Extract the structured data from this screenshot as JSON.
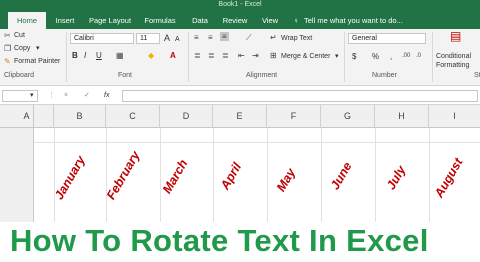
{
  "window": {
    "title": "Book1 - Excel"
  },
  "tabs": [
    "Home",
    "Insert",
    "Page Layout",
    "Formulas",
    "Data",
    "Review",
    "View"
  ],
  "tell_me": "Tell me what you want to do...",
  "clipboard": {
    "cut": "Cut",
    "copy": "Copy",
    "format_painter": "Format Painter",
    "label": "Clipboard"
  },
  "font": {
    "name": "Calibri",
    "size": "11",
    "label": "Font",
    "bold": "B",
    "italic": "I",
    "underline": "U"
  },
  "alignment": {
    "wrap_text": "Wrap Text",
    "merge_center": "Merge & Center",
    "label": "Alignment"
  },
  "number": {
    "format": "General",
    "label": "Number",
    "currency": "$",
    "percent": "%",
    "comma": ","
  },
  "styles": {
    "conditional": "Conditional",
    "formatting": "Formatting",
    "label": "St"
  },
  "formula_bar": {
    "fx": "fx",
    "cancel": "×",
    "enter": "✓"
  },
  "columns": [
    "A",
    "B",
    "C",
    "D",
    "E",
    "F",
    "G",
    "H",
    "I"
  ],
  "months": [
    "January",
    "February",
    "March",
    "April",
    "May",
    "June",
    "July",
    "August"
  ],
  "caption": "How To Rotate Text In Excel",
  "colors": {
    "excel_green": "#217346",
    "month_red": "#c00000",
    "caption_green": "#1f9a4a"
  }
}
